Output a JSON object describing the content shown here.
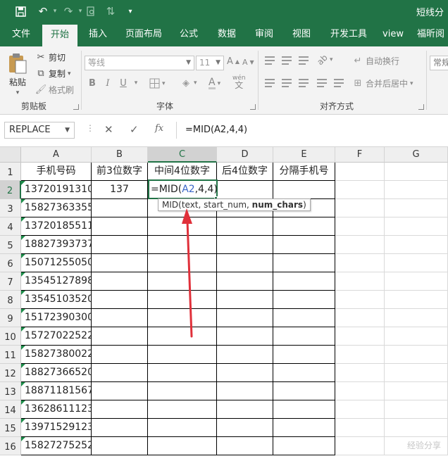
{
  "window": {
    "title": "短线分"
  },
  "quick_access": {
    "save_icon": "save-icon",
    "undo_icon": "undo-icon",
    "redo_icon": "redo-icon",
    "customize_icon": "chevron-down-icon"
  },
  "ribbon_tabs": [
    "文件",
    "开始",
    "插入",
    "页面布局",
    "公式",
    "数据",
    "审阅",
    "视图",
    "开发工具",
    "view",
    "福昕阅"
  ],
  "active_tab": "开始",
  "clipboard": {
    "paste_label": "粘贴",
    "cut_label": "剪切",
    "copy_label": "复制",
    "format_painter_label": "格式刷",
    "group_label": "剪贴板"
  },
  "font": {
    "font_name": "等线",
    "font_size": "11",
    "bold": "B",
    "italic": "I",
    "underline": "U",
    "phonetic": "wén",
    "group_label": "字体"
  },
  "alignment": {
    "wrap_text_label": "自动换行",
    "merge_center_label": "合并后居中",
    "group_label": "对齐方式"
  },
  "number": {
    "format_value": "常规"
  },
  "formula_bar": {
    "name_box": "REPLACE",
    "cancel_glyph": "✕",
    "enter_glyph": "✓",
    "fx_label": "fx",
    "formula": "=MID(A2,4,4)"
  },
  "columns": [
    "A",
    "B",
    "C",
    "D",
    "E",
    "F",
    "G"
  ],
  "selected_column": "C",
  "rows": [
    "1",
    "2",
    "3",
    "4",
    "5",
    "6",
    "7",
    "8",
    "9",
    "10",
    "11",
    "12",
    "13",
    "14",
    "15",
    "16"
  ],
  "selected_row": "2",
  "headers": [
    "手机号码",
    "前3位数字",
    "中间4位数字",
    "后4位数字",
    "分隔手机号"
  ],
  "phone_numbers": [
    "13720191310",
    "15827363355",
    "13720185511",
    "18827393737",
    "15071255050",
    "13545127898",
    "13545103520",
    "15172390300",
    "15727022522",
    "15827380022",
    "18827366520",
    "18871181567",
    "13628611123",
    "13971529123",
    "15827275252"
  ],
  "b2_value": "137",
  "active_cell": {
    "address": "C2",
    "prefix": "=MID(",
    "ref": "A2",
    "suffix": ",4,4)"
  },
  "tooltip": {
    "func": "MID(",
    "arg1": "text",
    "sep1": ", ",
    "arg2": "start_num",
    "sep2": ", ",
    "arg3": "num_chars",
    "end": ")"
  },
  "annotation": {
    "color": "#e0303a"
  },
  "accent_color": "#217346",
  "watermark": "经验分享"
}
